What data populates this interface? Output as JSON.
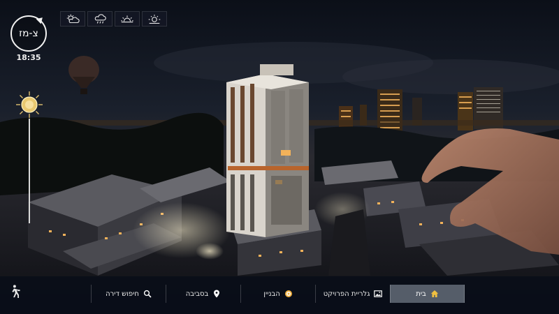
{
  "compass": {
    "label": "צ-מז"
  },
  "clock": {
    "time": "18:35"
  },
  "weather": [
    {
      "icon": "partly-cloudy-icon"
    },
    {
      "icon": "rain-cloud-icon"
    },
    {
      "icon": "sunset-icon"
    },
    {
      "icon": "sun-icon"
    }
  ],
  "nav": {
    "items": [
      {
        "label": "חיפוש דירה",
        "icon": "search-icon"
      },
      {
        "label": "בסביבה",
        "icon": "location-pin-icon"
      },
      {
        "label": "הבניין",
        "icon": "building-target-icon"
      },
      {
        "label": "גלריית הפרויקט",
        "icon": "gallery-image-icon"
      },
      {
        "label": "בית",
        "icon": "home-icon",
        "active": true
      }
    ]
  },
  "colors": {
    "nav_bg": "#0a0e18",
    "active_tab": "#b4becd",
    "window_light": "#f2b25a",
    "sky": "#121824"
  }
}
